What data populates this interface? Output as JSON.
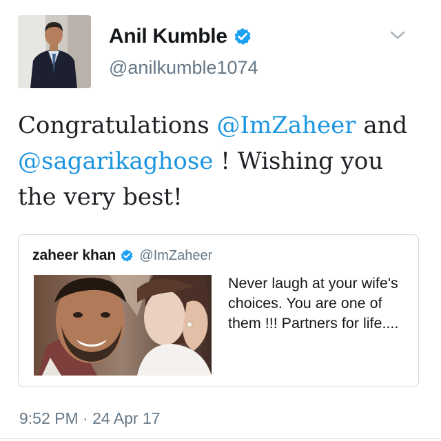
{
  "author": {
    "name": "Anil Kumble",
    "handle": "@anilkumble1074",
    "avatar_icon": "profile-photo-man-in-suit",
    "verified_icon": "verified-badge-icon"
  },
  "tweet": {
    "text_1": "Congratulations ",
    "mention_1": "@ImZaheer",
    "text_2": " and ",
    "mention_2": "@sagarikaghose",
    "text_3": " ! Wishing you the very best!"
  },
  "quoted": {
    "name": "zaheer khan",
    "handle": "@ImZaheer",
    "photo_icon": "couple-selfie-photo",
    "text": "Never laugh at your wife's choices. You are one of them !!! Partners for life...."
  },
  "timestamp": "9:52 PM · 24 Apr 17",
  "colors": {
    "mention": "#1b95e0",
    "verified": "#1da1f2",
    "secondary_text": "#657786",
    "border": "#cfd8df"
  }
}
